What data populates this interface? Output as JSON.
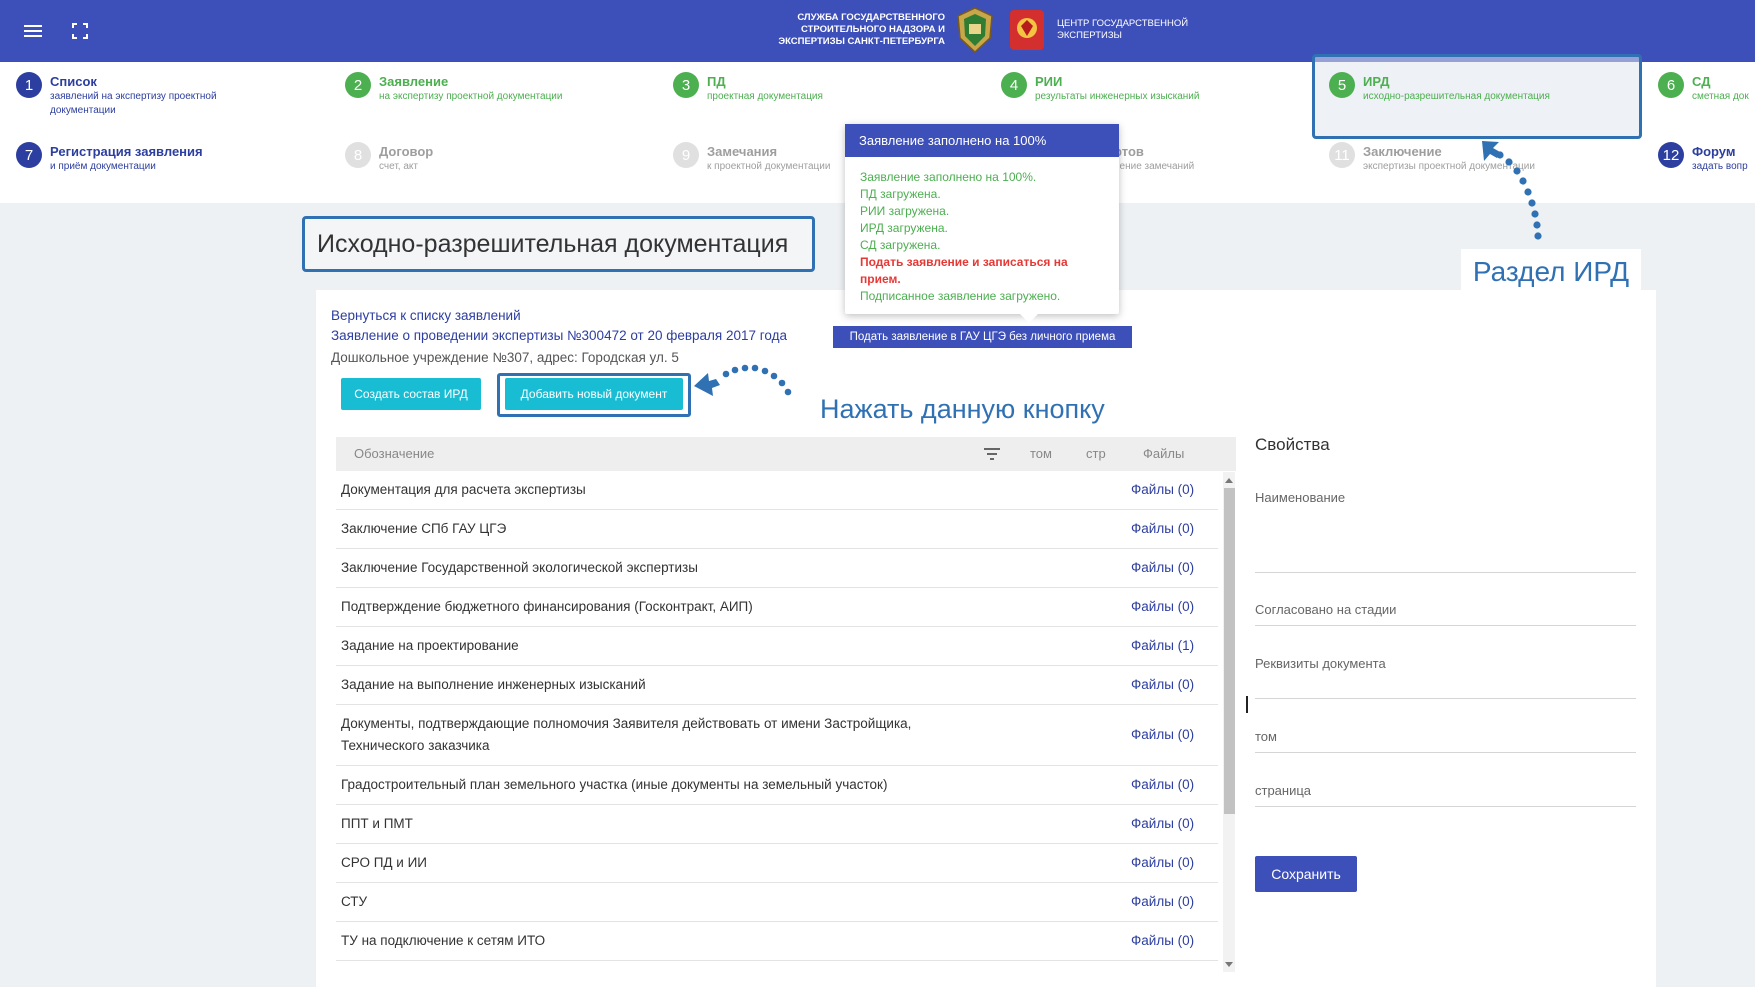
{
  "header": {
    "org_left": "СЛУЖБА ГОСУДАРСТВЕННОГО СТРОИТЕЛЬНОГО НАДЗОРА И ЭКСПЕРТИЗЫ САНКТ-ПЕТЕРБУРГА",
    "org_right": "ЦЕНТР ГОСУДАРСТВЕННОЙ ЭКСПЕРТИЗЫ",
    "menu_icon": "hamburger-icon",
    "fullscreen_icon": "fullscreen-icon"
  },
  "steps": [
    {
      "num": "1",
      "title": "Список",
      "sub": "заявлений на экспертизу проектной",
      "sub2": "документации"
    },
    {
      "num": "2",
      "title": "Заявление",
      "sub": "на экспертизу проектной документации"
    },
    {
      "num": "3",
      "title": "ПД",
      "sub": "проектная документация"
    },
    {
      "num": "4",
      "title": "РИИ",
      "sub": "результаты инженерных изысканий"
    },
    {
      "num": "5",
      "title": "ИРД",
      "sub": "исходно-разрешительная документация"
    },
    {
      "num": "6",
      "title": "СД",
      "sub": "сметная док"
    },
    {
      "num": "7",
      "title": "Регистрация заявления",
      "sub": "и приём документации"
    },
    {
      "num": "8",
      "title": "Договор",
      "sub": "счет, акт"
    },
    {
      "num": "9",
      "title": "Замечания",
      "sub": "к проектной документации"
    },
    {
      "num": "10",
      "title": "ртов",
      "sub": "нение замечаний"
    },
    {
      "num": "11",
      "title": "Заключение",
      "sub": "экспертизы проектной документации"
    },
    {
      "num": "12",
      "title": "Форум",
      "sub": "задать вопр"
    }
  ],
  "tooltip": {
    "title": "Заявление заполнено на 100%",
    "lines": [
      "Заявление заполнено на 100%.",
      "ПД загружена.",
      "РИИ загружена.",
      "ИРД загружена.",
      "СД загружена."
    ],
    "warning": "Подать заявление и записаться на прием.",
    "last_line": "Подписанное заявление загружено.",
    "submit_button": "Подать заявление в ГАУ ЦГЭ без личного приема"
  },
  "page": {
    "title": "Исходно-разрешительная документация",
    "back_link": "Вернуться к списку заявлений",
    "application_link": "Заявление о проведении экспертизы №300472 от 20 февраля 2017 года",
    "object": "Дошкольное учреждение №307, адрес: Городская ул. 5",
    "create_button": "Создать состав ИРД",
    "add_button": "Добавить новый документ"
  },
  "annotations": {
    "ird_section": "Раздел ИРД",
    "click_button": "Нажать данную кнопку"
  },
  "table": {
    "headers": {
      "designation": "Обозначение",
      "volume": "том",
      "page": "стр",
      "files": "Файлы"
    },
    "filter_icon": "filter-icon",
    "rows": [
      {
        "name": "Документация для расчета экспертизы",
        "files": "Файлы (0)"
      },
      {
        "name": "Заключение СПб ГАУ ЦГЭ",
        "files": "Файлы (0)"
      },
      {
        "name": "Заключение Государственной экологической экспертизы",
        "files": "Файлы (0)"
      },
      {
        "name": "Подтверждение бюджетного финансирования (Госконтракт, АИП)",
        "files": "Файлы (0)"
      },
      {
        "name": "Задание на проектирование",
        "files": "Файлы (1)"
      },
      {
        "name": "Задание на выполнение инженерных изысканий",
        "files": "Файлы (0)"
      },
      {
        "name": "Документы, подтверждающие полномочия Заявителя действовать от имени Застройщика,",
        "name2": "Технического заказчика",
        "files": "Файлы (0)"
      },
      {
        "name": "Градостроительный план земельного участка (иные документы на земельный участок)",
        "files": "Файлы (0)"
      },
      {
        "name": "ППТ и ПМТ",
        "files": "Файлы (0)"
      },
      {
        "name": "СРО ПД и ИИ",
        "files": "Файлы (0)"
      },
      {
        "name": "СТУ",
        "files": "Файлы (0)"
      },
      {
        "name": "ТУ на подключение к сетям ИТО",
        "files": "Файлы (0)"
      }
    ]
  },
  "properties": {
    "title": "Свойства",
    "name_label": "Наименование",
    "stage_label": "Согласовано на стадии",
    "requisites_label": "Реквизиты документа",
    "volume_label": "том",
    "page_label": "страница",
    "save_button": "Сохранить"
  },
  "colors": {
    "header": "#3d4fb8",
    "step_blue": "#2c3e9f",
    "step_green": "#4caf50",
    "cyan_button": "#18bcd3",
    "annotation": "#2f71b3",
    "warning_red": "#e53935"
  }
}
